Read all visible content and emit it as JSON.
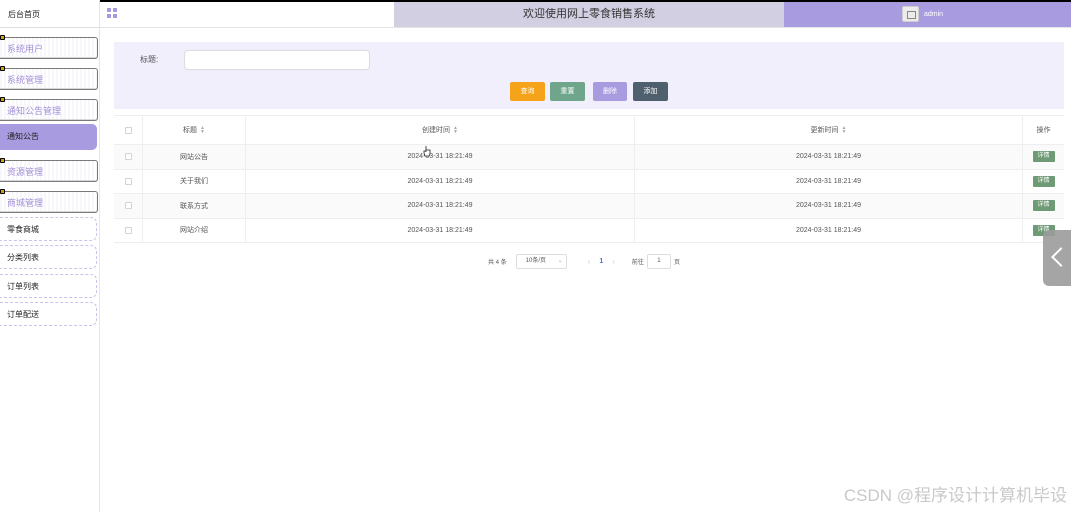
{
  "sidebar": {
    "home": "后台首页",
    "groups": [
      {
        "label": "系统用户"
      },
      {
        "label": "系统管理"
      },
      {
        "label": "通知公告管理"
      }
    ],
    "active_item": "通知公告",
    "groups_after": [
      {
        "label": "资源管理"
      },
      {
        "label": "商城管理"
      }
    ],
    "sub_items": [
      "零食商城",
      "分类列表",
      "订单列表",
      "订单配送"
    ]
  },
  "header": {
    "title": "欢迎使用网上零食销售系统",
    "username": "admin"
  },
  "search": {
    "label": "标题:",
    "input_value": "",
    "buttons": {
      "query": "查询",
      "reset": "重置",
      "delete": "删除",
      "add": "添加"
    }
  },
  "table": {
    "columns": {
      "title": "标题",
      "created": "创建时间",
      "updated": "更新时间",
      "operation": "操作"
    },
    "rows": [
      {
        "title": "网站公告",
        "created": "2024-03-31 18:21:49",
        "updated": "2024-03-31 18:21:49",
        "action": "详情"
      },
      {
        "title": "关于我们",
        "created": "2024-03-31 18:21:49",
        "updated": "2024-03-31 18:21:49",
        "action": "详情"
      },
      {
        "title": "联系方式",
        "created": "2024-03-31 18:21:49",
        "updated": "2024-03-31 18:21:49",
        "action": "详情"
      },
      {
        "title": "网站介绍",
        "created": "2024-03-31 18:21:49",
        "updated": "2024-03-31 18:21:49",
        "action": "详情"
      }
    ]
  },
  "pagination": {
    "total": "共 4 条",
    "page_size": "10条/页",
    "current_page": "1",
    "goto_label": "前往",
    "goto_value": "1",
    "page_unit": "页"
  },
  "watermark": "CSDN @程序设计计算机毕设",
  "colors": {
    "accent": "#a99be0",
    "query": "#f5a31a",
    "reset": "#6fa58b",
    "delete": "#a99be0",
    "add": "#4e5f6e",
    "detail": "#6e9a76"
  }
}
